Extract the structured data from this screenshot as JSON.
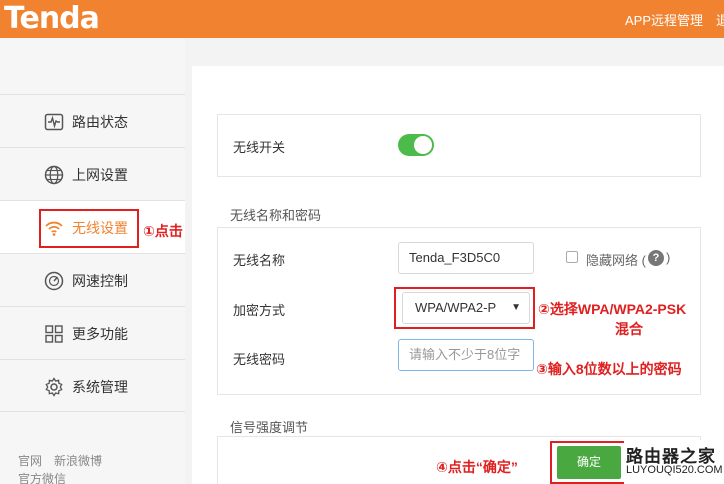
{
  "header": {
    "logo": "Tenda",
    "app_remote": "APP远程管理",
    "more": "退"
  },
  "sidebar": {
    "items": [
      {
        "label": "路由状态",
        "icon": "pulse-monitor-icon"
      },
      {
        "label": "上网设置",
        "icon": "globe-icon"
      },
      {
        "label": "无线设置",
        "icon": "wifi-icon",
        "active": true
      },
      {
        "label": "网速控制",
        "icon": "speedometer-icon"
      },
      {
        "label": "更多功能",
        "icon": "grid-icon"
      },
      {
        "label": "系统管理",
        "icon": "gear-icon"
      }
    ],
    "footer": {
      "link1": "官网",
      "link2": "新浪微博",
      "link3": "官方微信"
    }
  },
  "main": {
    "wireless_switch_label": "无线开关",
    "wireless_switch_on": true,
    "section_name_pwd": "无线名称和密码",
    "ssid_label": "无线名称",
    "ssid_value": "Tenda_F3D5C0",
    "hide_network_label": "隐藏网络 (",
    "hide_network_close": ")",
    "help_glyph": "?",
    "encryption_label": "加密方式",
    "encryption_value": "WPA/WPA2-P",
    "password_label": "无线密码",
    "password_placeholder": "请输入不少于8位字",
    "section_signal": "信号强度调节",
    "confirm_button": "确定"
  },
  "annotations": {
    "step1": "①点击",
    "step2_line1": "②选择WPA/WPA2-PSK",
    "step2_line2": "混合",
    "step3": "③输入8位数以上的密码",
    "step4": "④点击“确定”"
  },
  "watermark": {
    "title": "路由器之家",
    "url": "LUYOUQI520.COM"
  },
  "colors": {
    "brand_orange": "#f18330",
    "toggle_green": "#4cbb4a",
    "button_green": "#4aa841",
    "annotation_red": "#e02020"
  }
}
